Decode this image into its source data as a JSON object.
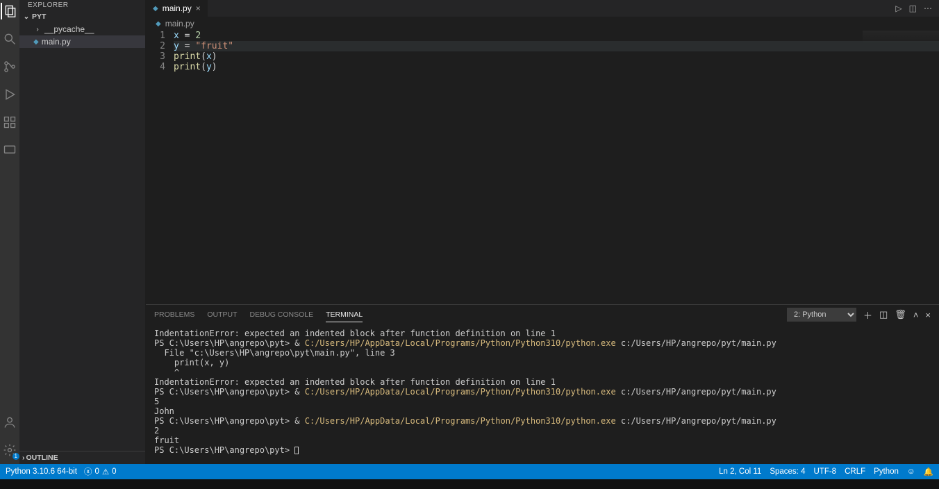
{
  "sidebar": {
    "title": "EXPLORER",
    "root": "PYT",
    "items": [
      {
        "label": "__pycache__",
        "type": "folder"
      },
      {
        "label": "main.py",
        "type": "file"
      }
    ],
    "outline": "OUTLINE"
  },
  "tab": {
    "label": "main.py"
  },
  "breadcrumb": {
    "file": "main.py"
  },
  "code": {
    "lines": [
      {
        "n": "1",
        "tokens": [
          [
            "var",
            "x"
          ],
          [
            "op",
            " = "
          ],
          [
            "num",
            "2"
          ]
        ]
      },
      {
        "n": "2",
        "tokens": [
          [
            "var",
            "y"
          ],
          [
            "op",
            " = "
          ],
          [
            "str",
            "\"fruit\""
          ]
        ],
        "current": true
      },
      {
        "n": "3",
        "tokens": [
          [
            "fn",
            "print"
          ],
          [
            "par",
            "("
          ],
          [
            "var",
            "x"
          ],
          [
            "par",
            ")"
          ]
        ]
      },
      {
        "n": "4",
        "tokens": [
          [
            "fn",
            "print"
          ],
          [
            "par",
            "("
          ],
          [
            "var",
            "y"
          ],
          [
            "par",
            ")"
          ]
        ]
      }
    ]
  },
  "panel": {
    "tabs": {
      "problems": "PROBLEMS",
      "output": "OUTPUT",
      "debug": "DEBUG CONSOLE",
      "terminal": "TERMINAL"
    },
    "selector": "2: Python"
  },
  "terminal": {
    "lines": [
      {
        "segments": [
          [
            "",
            "IndentationError: expected an indented block after function definition on line 1"
          ]
        ]
      },
      {
        "segments": [
          [
            "",
            "PS C:\\Users\\HP\\angrepo\\pyt> & "
          ],
          [
            "y",
            "C:/Users/HP/AppData/Local/Programs/Python/Python310/python.exe"
          ],
          [
            "",
            " c:/Users/HP/angrepo/pyt/main.py"
          ]
        ]
      },
      {
        "segments": [
          [
            "",
            "  File \"c:\\Users\\HP\\angrepo\\pyt\\main.py\", line 3"
          ]
        ]
      },
      {
        "segments": [
          [
            "",
            "    print(x, y)"
          ]
        ]
      },
      {
        "segments": [
          [
            "",
            "    ^"
          ]
        ]
      },
      {
        "segments": [
          [
            "",
            "IndentationError: expected an indented block after function definition on line 1"
          ]
        ]
      },
      {
        "segments": [
          [
            "",
            "PS C:\\Users\\HP\\angrepo\\pyt> & "
          ],
          [
            "y",
            "C:/Users/HP/AppData/Local/Programs/Python/Python310/python.exe"
          ],
          [
            "",
            " c:/Users/HP/angrepo/pyt/main.py"
          ]
        ]
      },
      {
        "segments": [
          [
            "",
            "5"
          ]
        ]
      },
      {
        "segments": [
          [
            "",
            "John"
          ]
        ]
      },
      {
        "segments": [
          [
            "",
            "PS C:\\Users\\HP\\angrepo\\pyt> & "
          ],
          [
            "y",
            "C:/Users/HP/AppData/Local/Programs/Python/Python310/python.exe"
          ],
          [
            "",
            " c:/Users/HP/angrepo/pyt/main.py"
          ]
        ]
      },
      {
        "segments": [
          [
            "",
            "2"
          ]
        ]
      },
      {
        "segments": [
          [
            "",
            "fruit"
          ]
        ]
      },
      {
        "segments": [
          [
            "",
            "PS C:\\Users\\HP\\angrepo\\pyt> "
          ]
        ],
        "cursor": true
      }
    ]
  },
  "status": {
    "python": "Python 3.10.6 64-bit",
    "errors": "0",
    "warnings": "0",
    "lncol": "Ln 2, Col 11",
    "spaces": "Spaces: 4",
    "encoding": "UTF-8",
    "eol": "CRLF",
    "lang": "Python"
  },
  "activity_badge": "1"
}
